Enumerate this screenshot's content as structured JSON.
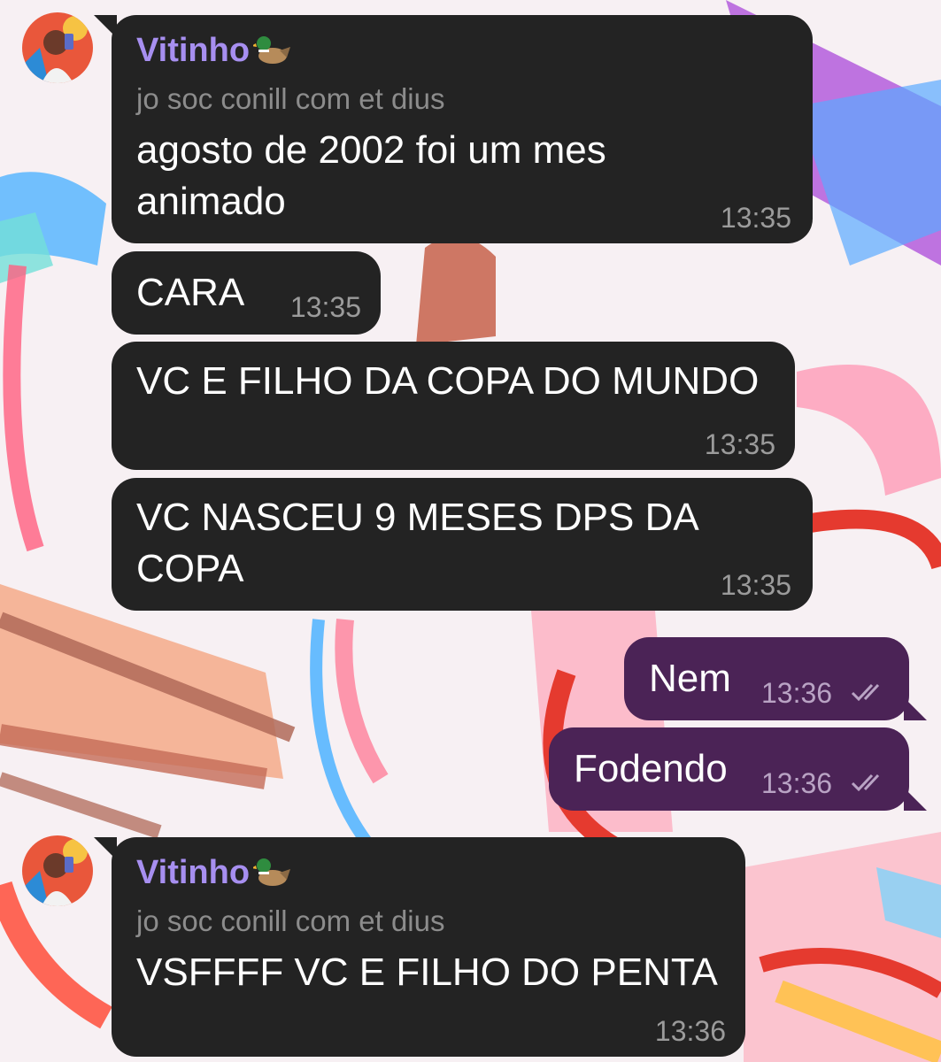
{
  "chat": {
    "messages": [
      {
        "direction": "incoming",
        "sender": "Vitinho",
        "sender_emoji": "duck-icon",
        "subtitle": "jo soc conill com et dius",
        "lines": [
          "agosto de 2002 foi um mes",
          "animado"
        ],
        "time": "13:35"
      },
      {
        "direction": "incoming",
        "lines": [
          "CARA"
        ],
        "time": "13:35"
      },
      {
        "direction": "incoming",
        "lines": [
          "VC E FILHO DA COPA DO MUNDO"
        ],
        "time": "13:35"
      },
      {
        "direction": "incoming",
        "lines": [
          "VC NASCEU 9 MESES DPS DA",
          "COPA"
        ],
        "time": "13:35"
      },
      {
        "direction": "outgoing",
        "lines": [
          "Nem"
        ],
        "time": "13:36",
        "status": "read",
        "status_icon": "double-check-icon"
      },
      {
        "direction": "outgoing",
        "lines": [
          "Fodendo"
        ],
        "time": "13:36",
        "status": "read",
        "status_icon": "double-check-icon"
      },
      {
        "direction": "incoming",
        "sender": "Vitinho",
        "sender_emoji": "duck-icon",
        "subtitle": "jo soc conill com et dius",
        "lines": [
          "VSFFFF VC E FILHO DO PENTA"
        ],
        "time": "13:36"
      }
    ]
  },
  "colors": {
    "incoming_bubble": "#232323",
    "outgoing_bubble": "#4b2356",
    "sender_name": "#a78ff0",
    "subtitle": "#8c8c8c"
  }
}
